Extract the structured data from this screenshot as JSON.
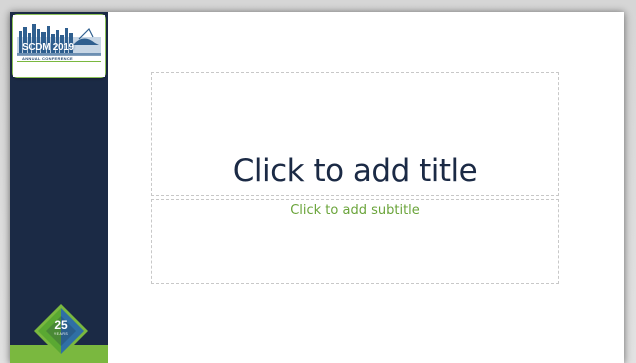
{
  "logo": {
    "name": "SCDM 2019",
    "subtitle": "ANNUAL CONFERENCE"
  },
  "badge": {
    "number": "25",
    "label": "YEARS"
  },
  "slide": {
    "title_placeholder": "Click to add title",
    "subtitle_placeholder": "Click to add subtitle"
  },
  "colors": {
    "sidebar": "#1b2a45",
    "accent_green": "#7ab83f",
    "title_text": "#1b2a45",
    "subtitle_text": "#6aa43a"
  }
}
